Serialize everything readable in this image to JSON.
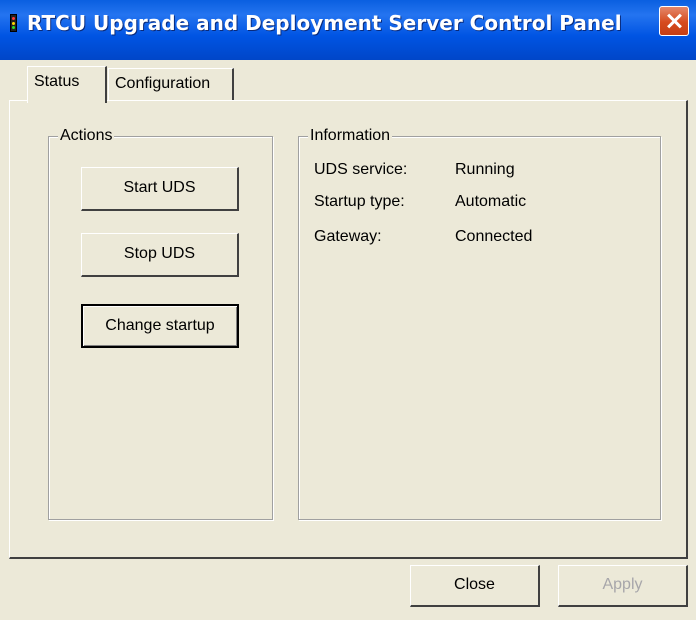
{
  "window": {
    "title": "RTCU Upgrade and Deployment Server Control Panel",
    "app_icon": "traffic-light-icon",
    "close_icon": "close-icon"
  },
  "tabs": [
    {
      "label": "Status",
      "selected": true
    },
    {
      "label": "Configuration",
      "selected": false
    }
  ],
  "actions": {
    "legend": "Actions",
    "start_label": "Start UDS",
    "stop_label": "Stop UDS",
    "change_startup_label": "Change startup"
  },
  "information": {
    "legend": "Information",
    "rows": [
      {
        "label": "UDS service:",
        "value": "Running"
      },
      {
        "label": "Startup type:",
        "value": "Automatic"
      },
      {
        "label": "Gateway:",
        "value": "Connected"
      }
    ]
  },
  "footer": {
    "close_label": "Close",
    "apply_label": "Apply",
    "apply_enabled": false
  },
  "colors": {
    "titlebar": "#0054e3",
    "face": "#ece9d8",
    "close_button": "#d64b1e"
  }
}
